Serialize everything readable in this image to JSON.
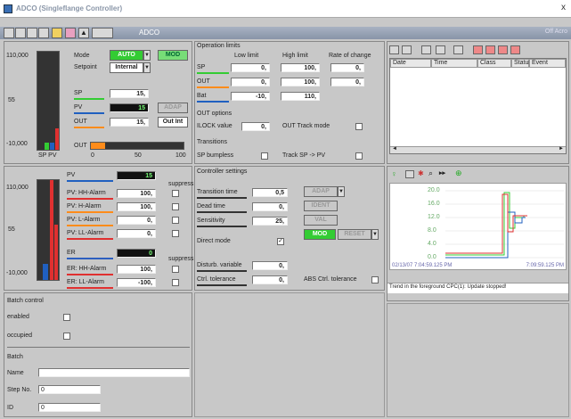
{
  "window": {
    "title": "ADCO (Singleflange Controller)",
    "close": "x"
  },
  "toolbar": {
    "name": "ADCO",
    "right": "Off Acro"
  },
  "colors": {
    "green": "#33cc33",
    "blue": "#2060c0",
    "orange": "#ff8c1a",
    "red": "#e03030",
    "bartrend_blue": "#2d5fbf"
  },
  "ctrl": {
    "y_top": "110,000",
    "y_mid": "55",
    "y_bot": "-10,000",
    "y_foot": "SP PV",
    "mode_label": "Mode",
    "mode_value": "AUTO",
    "mode_btn": "MOD",
    "setpoint_label": "Setpoint",
    "setpoint_value": "Internal",
    "sp_label": "SP",
    "sp_value": "15,",
    "pv_label": "PV",
    "pv_value": "15",
    "out_label": "OUT",
    "out_value": "15,",
    "adap": "ADAP",
    "outint": "Out Int",
    "out_bar_label": "OUT",
    "scale0": "0",
    "scale50": "50",
    "scale100": "100"
  },
  "ops": {
    "title": "Operation limits",
    "col_low": "Low limit",
    "col_high": "High limit",
    "col_roc": "Rate of change",
    "rows": [
      {
        "label": "SP",
        "low": "0,",
        "high": "100,",
        "roc": "0,"
      },
      {
        "label": "OUT",
        "low": "0,",
        "high": "100,",
        "roc": "0,"
      },
      {
        "label": "Bat",
        "low": "-10,",
        "high": "110,",
        "roc": ""
      }
    ],
    "out_options": "OUT options",
    "ilock_label": "ILOCK value",
    "ilock_value": "0,",
    "out_track": "OUT Track mode",
    "transitions": "Transitions",
    "sp_bumpless": "SP bumpless",
    "track_sp": "Track SP -> PV"
  },
  "alarm": {
    "title": "Operation messages",
    "columns": [
      "Date",
      "Time",
      "Class",
      "Status",
      "Event"
    ]
  },
  "pv": {
    "y_top": "110,000",
    "y_mid": "55",
    "y_bot": "-10,000",
    "pv_label": "PV",
    "pv_value": "15",
    "suppress": "suppress",
    "hh": "PV: HH-Alarm",
    "hh_value": "100,",
    "h": "PV: H-Alarm",
    "h_value": "100,",
    "l": "PV: L-Alarm",
    "l_value": "0,",
    "ll": "PV: LL-Alarm",
    "ll_value": "0,",
    "er_label": "ER",
    "er_value": "0",
    "suppress2": "suppress",
    "er_hh": "ER: HH-Alarm",
    "er_hh_value": "100,",
    "er_ll": "ER: LL-Alarm",
    "er_ll_value": "-100,"
  },
  "settings": {
    "title": "Controller settings",
    "tt": "Transition time",
    "tt_value": "0,5",
    "dead": "Dead time",
    "dead_value": "0,",
    "sens": "Sensitivity",
    "sens_value": "25,",
    "direct": "Direct mode",
    "dist": "Disturb. variable",
    "dist_value": "0,",
    "tol": "Ctrl. tolerance",
    "tol_value": "0,",
    "abs_tol": "ABS Ctrl. tolerance",
    "adap": "ADAP",
    "ident": "IDENT",
    "val": "VAL",
    "mod": "MOD",
    "reset": "RESET"
  },
  "trend": {
    "yticks": [
      "20.0",
      "16.0",
      "12.0",
      "8.0",
      "4.0",
      "0.0"
    ],
    "xstart": "02/13/07 7:04:59.125 PM",
    "xend": "7:09:59.125 PM",
    "status": "Trend in the foreground CPC(1): Update stopped!"
  },
  "batch": {
    "title": "Batch control",
    "enabled": "enabled",
    "occupied": "occupied",
    "batch": "Batch",
    "name": "Name",
    "stepno": "Step No.",
    "stepno_value": "0",
    "id": "ID",
    "id_value": "0"
  }
}
